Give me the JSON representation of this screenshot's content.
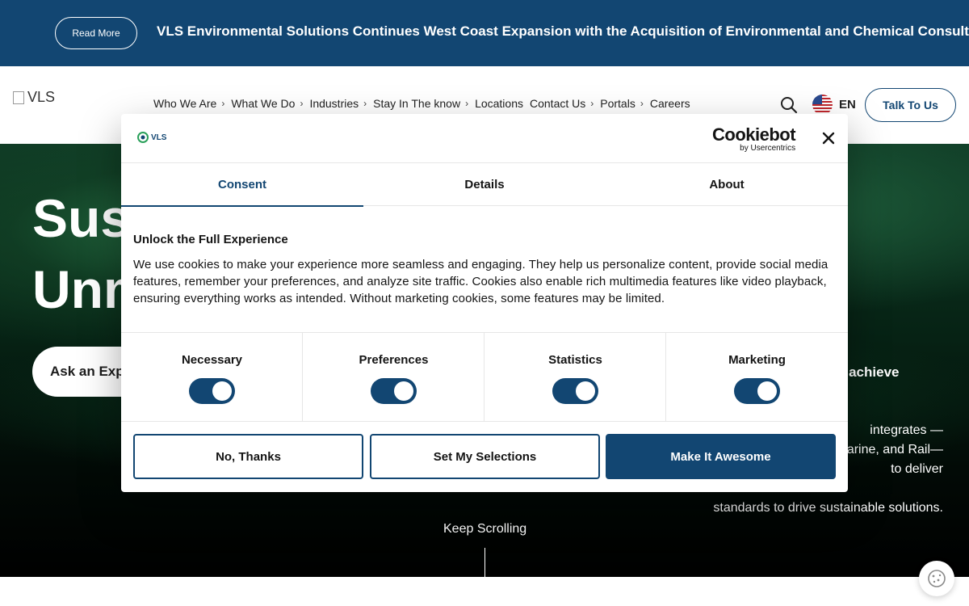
{
  "banner": {
    "read_more_label": "Read More",
    "headline": "VLS Environmental Solutions Continues West Coast Expansion with the Acquisition of Environmental and Chemical Consulting",
    "background_color": "#124672"
  },
  "header": {
    "logo_alt": "VLS",
    "nav": [
      "Who We Are",
      "What We Do",
      "Industries",
      "Stay In The know",
      "Locations",
      "Contact Us",
      "Portals",
      "Careers"
    ],
    "nav_has_chevron": [
      true,
      true,
      true,
      true,
      false,
      true,
      true,
      false
    ],
    "language": "EN",
    "talk_label": "Talk To Us"
  },
  "hero": {
    "title_line1": "Sust",
    "title_line2": "Unm",
    "ask_label": "Ask an Expe",
    "right_tag": "g achieve",
    "right_lines": [
      "integrates —",
      "arine, and Rail—",
      "to deliver",
      "standards to drive sustainable solutions."
    ],
    "keep_scrolling": "Keep Scrolling"
  },
  "cookie_dialog": {
    "logo_text": "VLS",
    "provider_name": "Cookiebot",
    "provider_sub": "by Usercentrics",
    "tabs": [
      {
        "label": "Consent",
        "active": true
      },
      {
        "label": "Details",
        "active": false
      },
      {
        "label": "About",
        "active": false
      }
    ],
    "title": "Unlock the Full Experience",
    "text": "We use cookies to make your experience more seamless and engaging. They help us personalize content, provide social media features, remember your preferences, and analyze site traffic. Cookies also enable rich multimedia features like video playback, ensuring everything works as intended. Without marketing cookies, some features may be limited.",
    "categories": [
      {
        "label": "Necessary",
        "enabled": true
      },
      {
        "label": "Preferences",
        "enabled": true
      },
      {
        "label": "Statistics",
        "enabled": true
      },
      {
        "label": "Marketing",
        "enabled": true
      }
    ],
    "buttons": {
      "no_thanks": "No, Thanks",
      "set_selections": "Set My Selections",
      "make_awesome": "Make It Awesome"
    },
    "accent_color": "#124672"
  },
  "icons": [
    "search-icon",
    "us-flag-icon",
    "close-icon",
    "chevron-right-icon",
    "cookie-settings-icon"
  ]
}
